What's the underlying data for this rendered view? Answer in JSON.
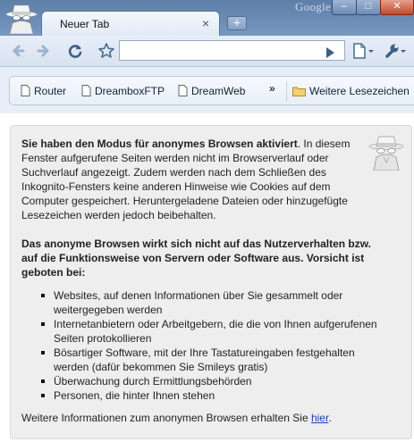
{
  "window": {
    "brand_label": "Google",
    "minimize_glyph": "–",
    "maximize_glyph": "□",
    "close_glyph": "✕"
  },
  "tabs": [
    {
      "label": "Neuer Tab",
      "close_glyph": "×"
    }
  ],
  "new_tab_glyph": "+",
  "toolbar": {
    "icons": [
      "back-icon",
      "forward-icon",
      "reload-icon",
      "bookmark-star-icon",
      "go-icon",
      "page-menu-icon",
      "wrench-icon"
    ],
    "omnibox_value": ""
  },
  "bookmarks": {
    "items": [
      {
        "label": "Router",
        "icon": "page-icon"
      },
      {
        "label": "DreamboxFTP",
        "icon": "page-icon"
      },
      {
        "label": "DreamWeb",
        "icon": "page-icon"
      }
    ],
    "overflow_glyph": "»",
    "other_folder": {
      "label": "Weitere Lesezeichen",
      "icon": "folder-icon"
    }
  },
  "incognito": {
    "heading": "Sie haben den Modus für anonymes Browsen aktiviert",
    "intro_rest": ". In diesem Fenster aufgerufene Seiten werden nicht im Browserverlauf oder Suchverlauf angezeigt. Zudem werden nach dem Schließen des Inkognito-Fensters keine anderen Hinweise wie Cookies auf dem Computer gespeichert. Heruntergeladene Dateien oder hinzugefügte Lesezeichen werden jedoch beibehalten.",
    "warning": "Das anonyme Browsen wirkt sich nicht auf das Nutzerverhalten bzw. auf die Funktionsweise von Servern oder Software aus. Vorsicht ist geboten bei:",
    "risks": [
      "Websites, auf denen Informationen über Sie gesammelt oder weitergegeben werden",
      "Internetanbietern oder Arbeitgebern, die die von Ihnen aufgerufenen Seiten protokollieren",
      "Bösartiger Software, mit der Ihre Tastatureingaben festgehalten werden (dafür bekommen Sie Smileys gratis)",
      "Überwachung durch Ermittlungsbehörden",
      "Personen, die hinter Ihnen stehen"
    ],
    "more_info_prefix": "Weitere Informationen zum anonymen Browsen erhalten Sie ",
    "more_info_link": "hier",
    "more_info_suffix": "."
  },
  "colors": {
    "titlebar": "#6d8db6",
    "link": "#1c3fb0",
    "panel": "#eeeeee"
  }
}
